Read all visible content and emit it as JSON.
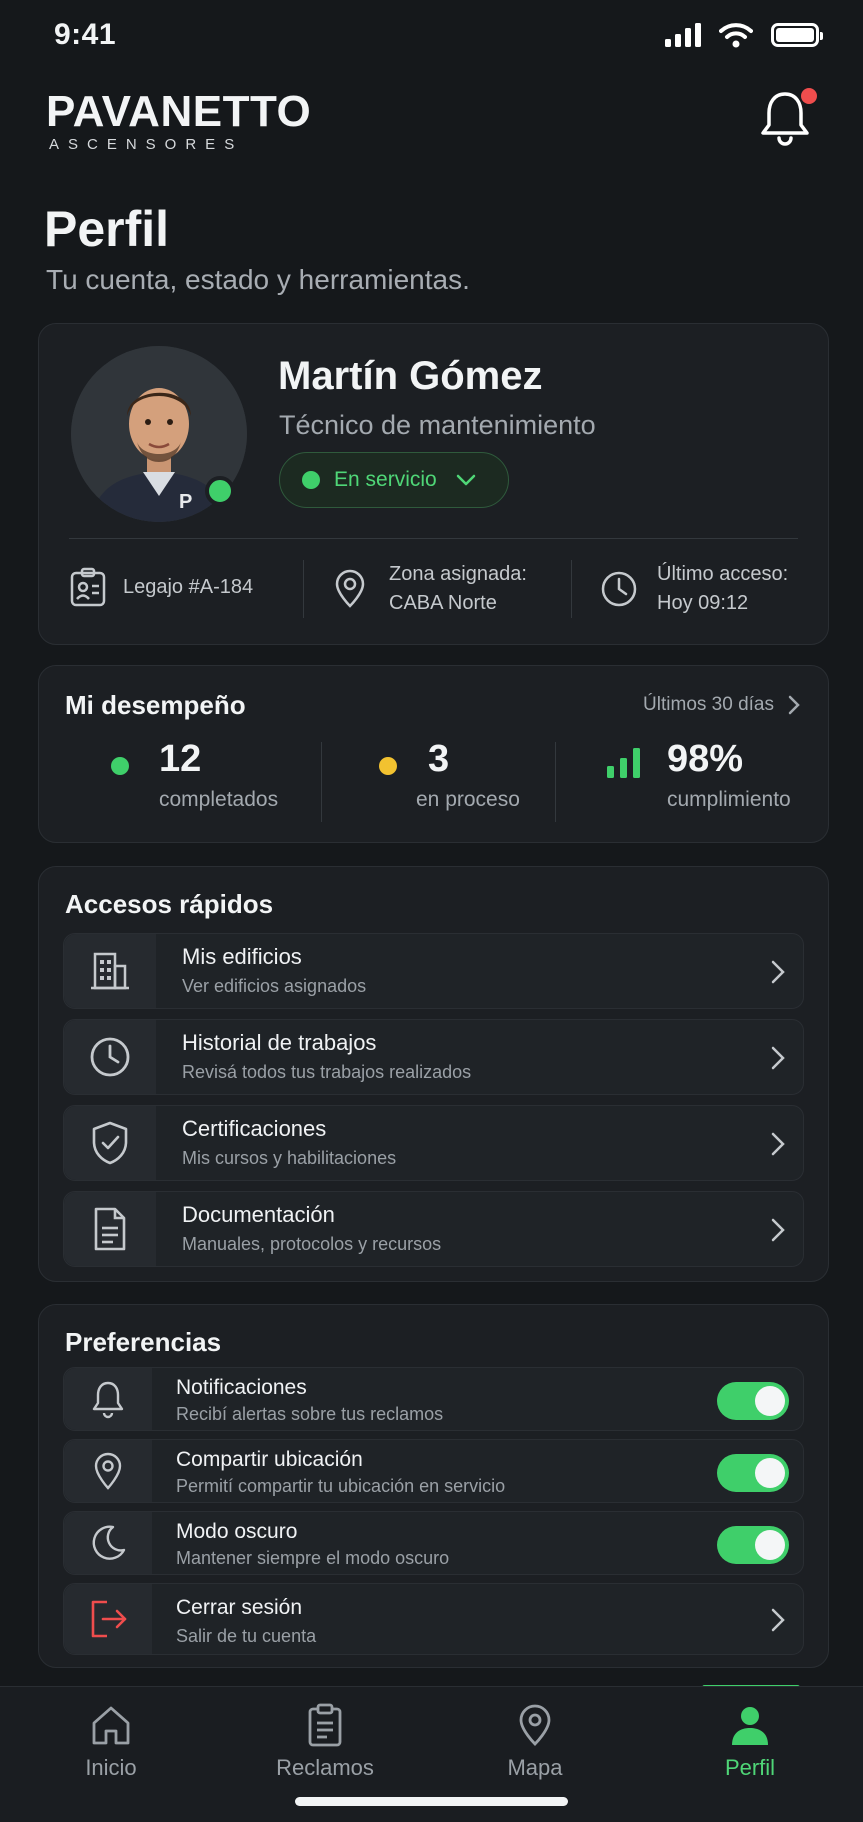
{
  "status_bar": {
    "time": "9:41"
  },
  "brand": {
    "name": "PAVANETTO",
    "sub": "ASCENSORES"
  },
  "page": {
    "title": "Perfil",
    "subtitle": "Tu cuenta, estado y herramientas."
  },
  "profile": {
    "name": "Martín Gómez",
    "role": "Técnico de mantenimiento",
    "status": "En servicio",
    "badge_letter": "P",
    "legajo": "Legajo #A-184",
    "zona_label": "Zona asignada:",
    "zona_value": "CABA Norte",
    "acceso_label": "Último acceso:",
    "acceso_value": "Hoy 09:12"
  },
  "performance": {
    "title": "Mi desempeño",
    "range": "Últimos 30 días",
    "metrics": [
      {
        "value": "12",
        "label": "completados",
        "color": "#3fcf6a"
      },
      {
        "value": "3",
        "label": "en proceso",
        "color": "#f2c230"
      },
      {
        "value": "98%",
        "label": "cumplimiento",
        "color": "#3fcf6a"
      }
    ]
  },
  "quick_access": {
    "title": "Accesos rápidos",
    "items": [
      {
        "title": "Mis edificios",
        "subtitle": "Ver edificios asignados",
        "icon": "building-icon"
      },
      {
        "title": "Historial de trabajos",
        "subtitle": "Revisá todos tus trabajos realizados",
        "icon": "clock-icon"
      },
      {
        "title": "Certificaciones",
        "subtitle": "Mis cursos y habilitaciones",
        "icon": "shield-check-icon"
      },
      {
        "title": "Documentación",
        "subtitle": "Manuales, protocolos y recursos",
        "icon": "document-icon"
      }
    ]
  },
  "preferences": {
    "title": "Preferencias",
    "items": [
      {
        "title": "Notificaciones",
        "subtitle": "Recibí alertas sobre tus reclamos",
        "icon": "bell-icon",
        "enabled": true
      },
      {
        "title": "Compartir ubicación",
        "subtitle": "Permití compartir tu ubicación en servicio",
        "icon": "location-pin-icon",
        "enabled": true
      },
      {
        "title": "Modo oscuro",
        "subtitle": "Mantener siempre el modo oscuro",
        "icon": "moon-icon",
        "enabled": true
      },
      {
        "title": "Cerrar sesión",
        "subtitle": "Salir de tu cuenta",
        "icon": "logout-icon"
      }
    ]
  },
  "nav": {
    "items": [
      {
        "label": "Inicio",
        "icon": "home-icon"
      },
      {
        "label": "Reclamos",
        "icon": "clipboard-icon"
      },
      {
        "label": "Mapa",
        "icon": "map-pin-icon"
      },
      {
        "label": "Perfil",
        "icon": "user-icon",
        "active": true
      }
    ]
  },
  "colors": {
    "accent": "#3fcf6a",
    "warning": "#f2c230",
    "danger": "#ef4d4d",
    "background": "#15181b"
  }
}
